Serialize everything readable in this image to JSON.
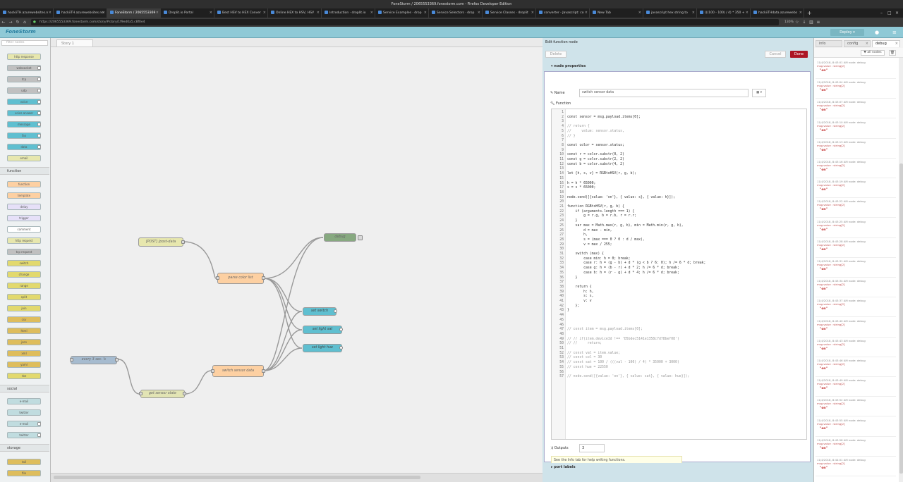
{
  "browser": {
    "window_title": "FoneStorm / 2065553369.fonestorm.com - Firefox Developer Edition",
    "tabs": [
      {
        "label": "hackiiTH.azurewebsites.n"
      },
      {
        "label": "hackiiTH.azurewebsites.ne"
      },
      {
        "label": "FoneStorm / 2065553369"
      },
      {
        "label": "Droplit.io Portal"
      },
      {
        "label": "Best HSV to HEX Conver"
      },
      {
        "label": "Online HEX to HSV, HSV"
      },
      {
        "label": "Introduction · droplit.io"
      },
      {
        "label": "Service Examples · drop"
      },
      {
        "label": "Service Selectors · drop"
      },
      {
        "label": "Service Classes · droplit"
      },
      {
        "label": "converter - Javascript: co"
      },
      {
        "label": "New Tab"
      },
      {
        "label": "javascript hex string to"
      },
      {
        "label": "(((100 - 100) / 4) * 350 +"
      },
      {
        "label": "hackiiTHdata.azurewebs"
      }
    ],
    "url": "https://2065553369.fonestorm.com/story/#story/1f9ed0a5.c8f0e4",
    "zoom": "130%"
  },
  "header": {
    "logo": "FoneStorm",
    "deploy_label": "Deploy"
  },
  "palette": {
    "filter_placeholder": "filter nodes",
    "categories": [
      {
        "label": "function"
      },
      {
        "label": "social"
      },
      {
        "label": "storage"
      }
    ],
    "nodes": [
      {
        "label": "http response"
      },
      {
        "label": "websocket"
      },
      {
        "label": "tcp"
      },
      {
        "label": "udp"
      },
      {
        "label": "voice"
      },
      {
        "label": "voice answer"
      },
      {
        "label": "message"
      },
      {
        "label": "fax"
      },
      {
        "label": "data"
      },
      {
        "label": "email"
      },
      {
        "label": "function"
      },
      {
        "label": "template"
      },
      {
        "label": "delay"
      },
      {
        "label": "trigger"
      },
      {
        "label": "comment"
      },
      {
        "label": "http request"
      },
      {
        "label": "tcp request"
      },
      {
        "label": "switch"
      },
      {
        "label": "change"
      },
      {
        "label": "range"
      },
      {
        "label": "split"
      },
      {
        "label": "join"
      },
      {
        "label": "csv"
      },
      {
        "label": "html"
      },
      {
        "label": "json"
      },
      {
        "label": "xml"
      },
      {
        "label": "yaml"
      },
      {
        "label": "rbe"
      },
      {
        "label": "e-mail"
      },
      {
        "label": "twitter"
      },
      {
        "label": "e-mail"
      },
      {
        "label": "twitter"
      },
      {
        "label": "tail"
      },
      {
        "label": "file"
      }
    ]
  },
  "workspace": {
    "tab_label": "Story 1",
    "nodes": [
      {
        "label": "[POST] /post-data"
      },
      {
        "label": "parse color list"
      },
      {
        "label": "debug"
      },
      {
        "label": "set switch"
      },
      {
        "label": "set light sat"
      },
      {
        "label": "set light hue"
      },
      {
        "label": "every 3 sec. ↻"
      },
      {
        "label": "switch sensor data"
      },
      {
        "label": "get sensor state"
      }
    ]
  },
  "editor": {
    "title": "Edit function node",
    "delete_label": "Delete",
    "cancel_label": "Cancel",
    "done_label": "Done",
    "properties_label": "node properties",
    "name_label": "Name",
    "name_value": "switch sensor data",
    "function_label": "Function",
    "outputs_label": "Outputs",
    "outputs_value": "3",
    "info_tip": "See the Info tab for help writing functions.",
    "port_labels": "port labels",
    "code_lines": [
      "",
      "const sensor = msg.payload.items[0];",
      "",
      "// return {",
      "//     value: sensor.status,",
      "// }",
      "",
      "const color = sensor.status;",
      "",
      "const r = color.substr(0, 2)",
      "const g = color.substr(2, 2)",
      "const b = color.substr(4, 2)",
      "",
      "let {h, s, v} = RGBtoHSV(r, g, b);",
      "",
      "h = h * 65000;",
      "s = s * 65000;",
      "",
      "node.send([{value: 'on'}, { value: s}, { value: h}]);",
      "",
      "function RGBtoHSV(r, g, b) {",
      "    if (arguments.length === 1) {",
      "        g = r.g, b = r.b, r = r.r;",
      "    }",
      "    var max = Math.max(r, g, b), min = Math.min(r, g, b),",
      "        d = max - min,",
      "        h,",
      "        s = (max === 0 ? 0 : d / max),",
      "        v = max / 255;",
      "",
      "    switch (max) {",
      "        case min: h = 0; break;",
      "        case r: h = (g - b) + d * (g < b ? 6: 0); h /= 6 * d; break;",
      "        case g: h = (b - r) + d * 2; h /= 6 * d; break;",
      "        case b: h = (r - g) + d * 4; h /= 6 * d; break;",
      "    }",
      "",
      "    return {",
      "        h: h,",
      "        s: s,",
      "        v: v",
      "    };",
      "}",
      "",
      "",
      "",
      "// const item = msg.payload.items[0];",
      "",
      "// // if(item.deviceId !== 'D5bdec5141e1358c7d78bef08')",
      "// //     return;",
      "",
      "// const val = item.value;",
      "// const col = 30",
      "// const sat = 100 / (((val - 100) / 4) * 35000 + 3000)",
      "// const hue = 22550",
      "",
      "// node.send([{value: 'on'}, { value: sat}, { value: hue}]);"
    ],
    "code_line_numbers": [
      "1",
      "2",
      "3",
      "4",
      "5",
      "6",
      "7",
      "8",
      "9",
      "10",
      "11",
      "12",
      "13",
      "14",
      "15",
      "16",
      "17",
      "18",
      "19",
      "20",
      "21",
      "22",
      "23",
      "24",
      "25",
      "26",
      "27",
      "28",
      "29",
      "30",
      "31",
      "32",
      "33",
      "34",
      "35",
      "36",
      "37",
      "38",
      "39",
      "40",
      "41",
      "42",
      "43",
      "44",
      "45",
      "46",
      "47",
      "48",
      "49",
      "50",
      "51",
      "52",
      "53",
      "54",
      "55",
      "56",
      "57"
    ]
  },
  "sidebar": {
    "tabs": [
      {
        "label": "info"
      },
      {
        "label": "config"
      },
      {
        "label": "debug"
      }
    ],
    "filter_label": "all nodes",
    "debug_messages": [
      {
        "meta": "11/4/2018, 8:43:01 AM   node: debug",
        "topic": "msg.value : string[2]",
        "value": "\"on\""
      },
      {
        "meta": "11/4/2018, 8:43:04 AM   node: debug",
        "topic": "msg.value : string[2]",
        "value": "\"on\""
      },
      {
        "meta": "11/4/2018, 8:43:07 AM   node: debug",
        "topic": "msg.value : string[2]",
        "value": "\"on\""
      },
      {
        "meta": "11/4/2018, 8:43:10 AM   node: debug",
        "topic": "msg.value : string[2]",
        "value": "\"on\""
      },
      {
        "meta": "11/4/2018, 8:43:13 AM   node: debug",
        "topic": "msg.value : string[2]",
        "value": "\"on\""
      },
      {
        "meta": "11/4/2018, 8:43:16 AM   node: debug",
        "topic": "msg.value : string[2]",
        "value": "\"on\""
      },
      {
        "meta": "11/4/2018, 8:43:19 AM   node: debug",
        "topic": "msg.value : string[2]",
        "value": "\"on\""
      },
      {
        "meta": "11/4/2018, 8:43:22 AM   node: debug",
        "topic": "msg.value : string[2]",
        "value": "\"on\""
      },
      {
        "meta": "11/4/2018, 8:43:25 AM   node: debug",
        "topic": "msg.value : string[2]",
        "value": "\"on\""
      },
      {
        "meta": "11/4/2018, 8:43:28 AM   node: debug",
        "topic": "msg.value : string[2]",
        "value": "\"on\""
      },
      {
        "meta": "11/4/2018, 8:43:31 AM   node: debug",
        "topic": "msg.value : string[2]",
        "value": "\"on\""
      },
      {
        "meta": "11/4/2018, 8:43:34 AM   node: debug",
        "topic": "msg.value : string[2]",
        "value": "\"on\""
      },
      {
        "meta": "11/4/2018, 8:43:37 AM   node: debug",
        "topic": "msg.value : string[2]",
        "value": "\"on\""
      },
      {
        "meta": "11/4/2018, 8:43:40 AM   node: debug",
        "topic": "msg.value : string[2]",
        "value": "\"on\""
      },
      {
        "meta": "11/4/2018, 8:43:43 AM   node: debug",
        "topic": "msg.value : string[2]",
        "value": "\"on\""
      },
      {
        "meta": "11/4/2018, 8:43:46 AM   node: debug",
        "topic": "msg.value : string[2]",
        "value": "\"on\""
      },
      {
        "meta": "11/4/2018, 8:43:49 AM   node: debug",
        "topic": "msg.value : string[2]",
        "value": "\"on\""
      },
      {
        "meta": "11/4/2018, 8:43:52 AM   node: debug",
        "topic": "msg.value : string[2]",
        "value": "\"on\""
      },
      {
        "meta": "11/4/2018, 8:43:55 AM   node: debug",
        "topic": "msg.value : string[2]",
        "value": "\"on\""
      },
      {
        "meta": "11/4/2018, 8:43:58 AM   node: debug",
        "topic": "msg.value : string[2]",
        "value": "\"on\""
      },
      {
        "meta": "11/4/2018, 8:44:01 AM   node: debug",
        "topic": "msg.value : string[2]",
        "value": "\"on\""
      }
    ]
  }
}
